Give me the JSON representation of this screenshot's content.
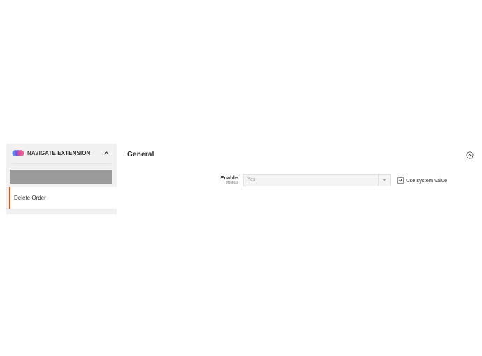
{
  "sidebar": {
    "header": {
      "logo_icon": "extension-logo-icon",
      "title": "NAVIGATE EXTENSION",
      "toggle_icon": "chevron-up-icon"
    },
    "items": [
      {
        "label": "Delete Order",
        "active": true
      }
    ]
  },
  "section": {
    "title": "General",
    "collapse_icon": "circle-chevron-up-icon"
  },
  "fields": {
    "enable": {
      "label": "Enable",
      "scope": "[global]",
      "value": "Yes",
      "use_system_value_label": "Use system value",
      "use_system_value_checked": true
    }
  },
  "colors": {
    "accent": "#eb5202",
    "sidebar_bg": "#f1f1f1",
    "logo_purple": "#7b4ee0",
    "logo_pink": "#e94b8b",
    "logo_blue": "#4f7ce8"
  }
}
